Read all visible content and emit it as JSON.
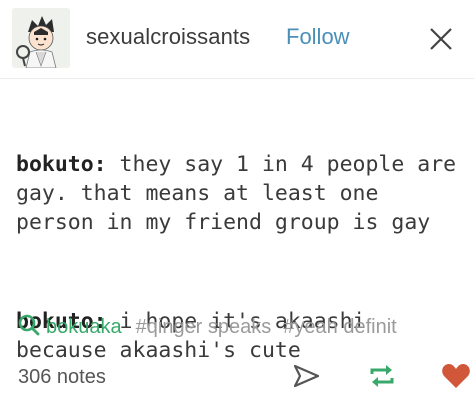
{
  "header": {
    "username": "sexualcroissants",
    "follow_label": "Follow"
  },
  "post": {
    "paragraphs": [
      {
        "speaker": "bokuto:",
        "text": " they say 1 in 4 people are gay. that means at least one person in my friend group is gay"
      },
      {
        "speaker": "bokuto:",
        "text": " i hope it's akaashi because akaashi's cute"
      }
    ]
  },
  "tags": [
    "bokuaka",
    "#qinger speaks",
    "#yeah definit"
  ],
  "footer": {
    "notes": "306 notes"
  },
  "colors": {
    "follow": "#4a8fb8",
    "first_tag": "#39a86b",
    "reblog": "#39a86b",
    "like": "#d0573a"
  },
  "icons": {
    "close": "close-icon",
    "tag": "search-icon",
    "share": "share-arrow-icon",
    "reblog": "reblog-icon",
    "like": "heart-icon"
  }
}
